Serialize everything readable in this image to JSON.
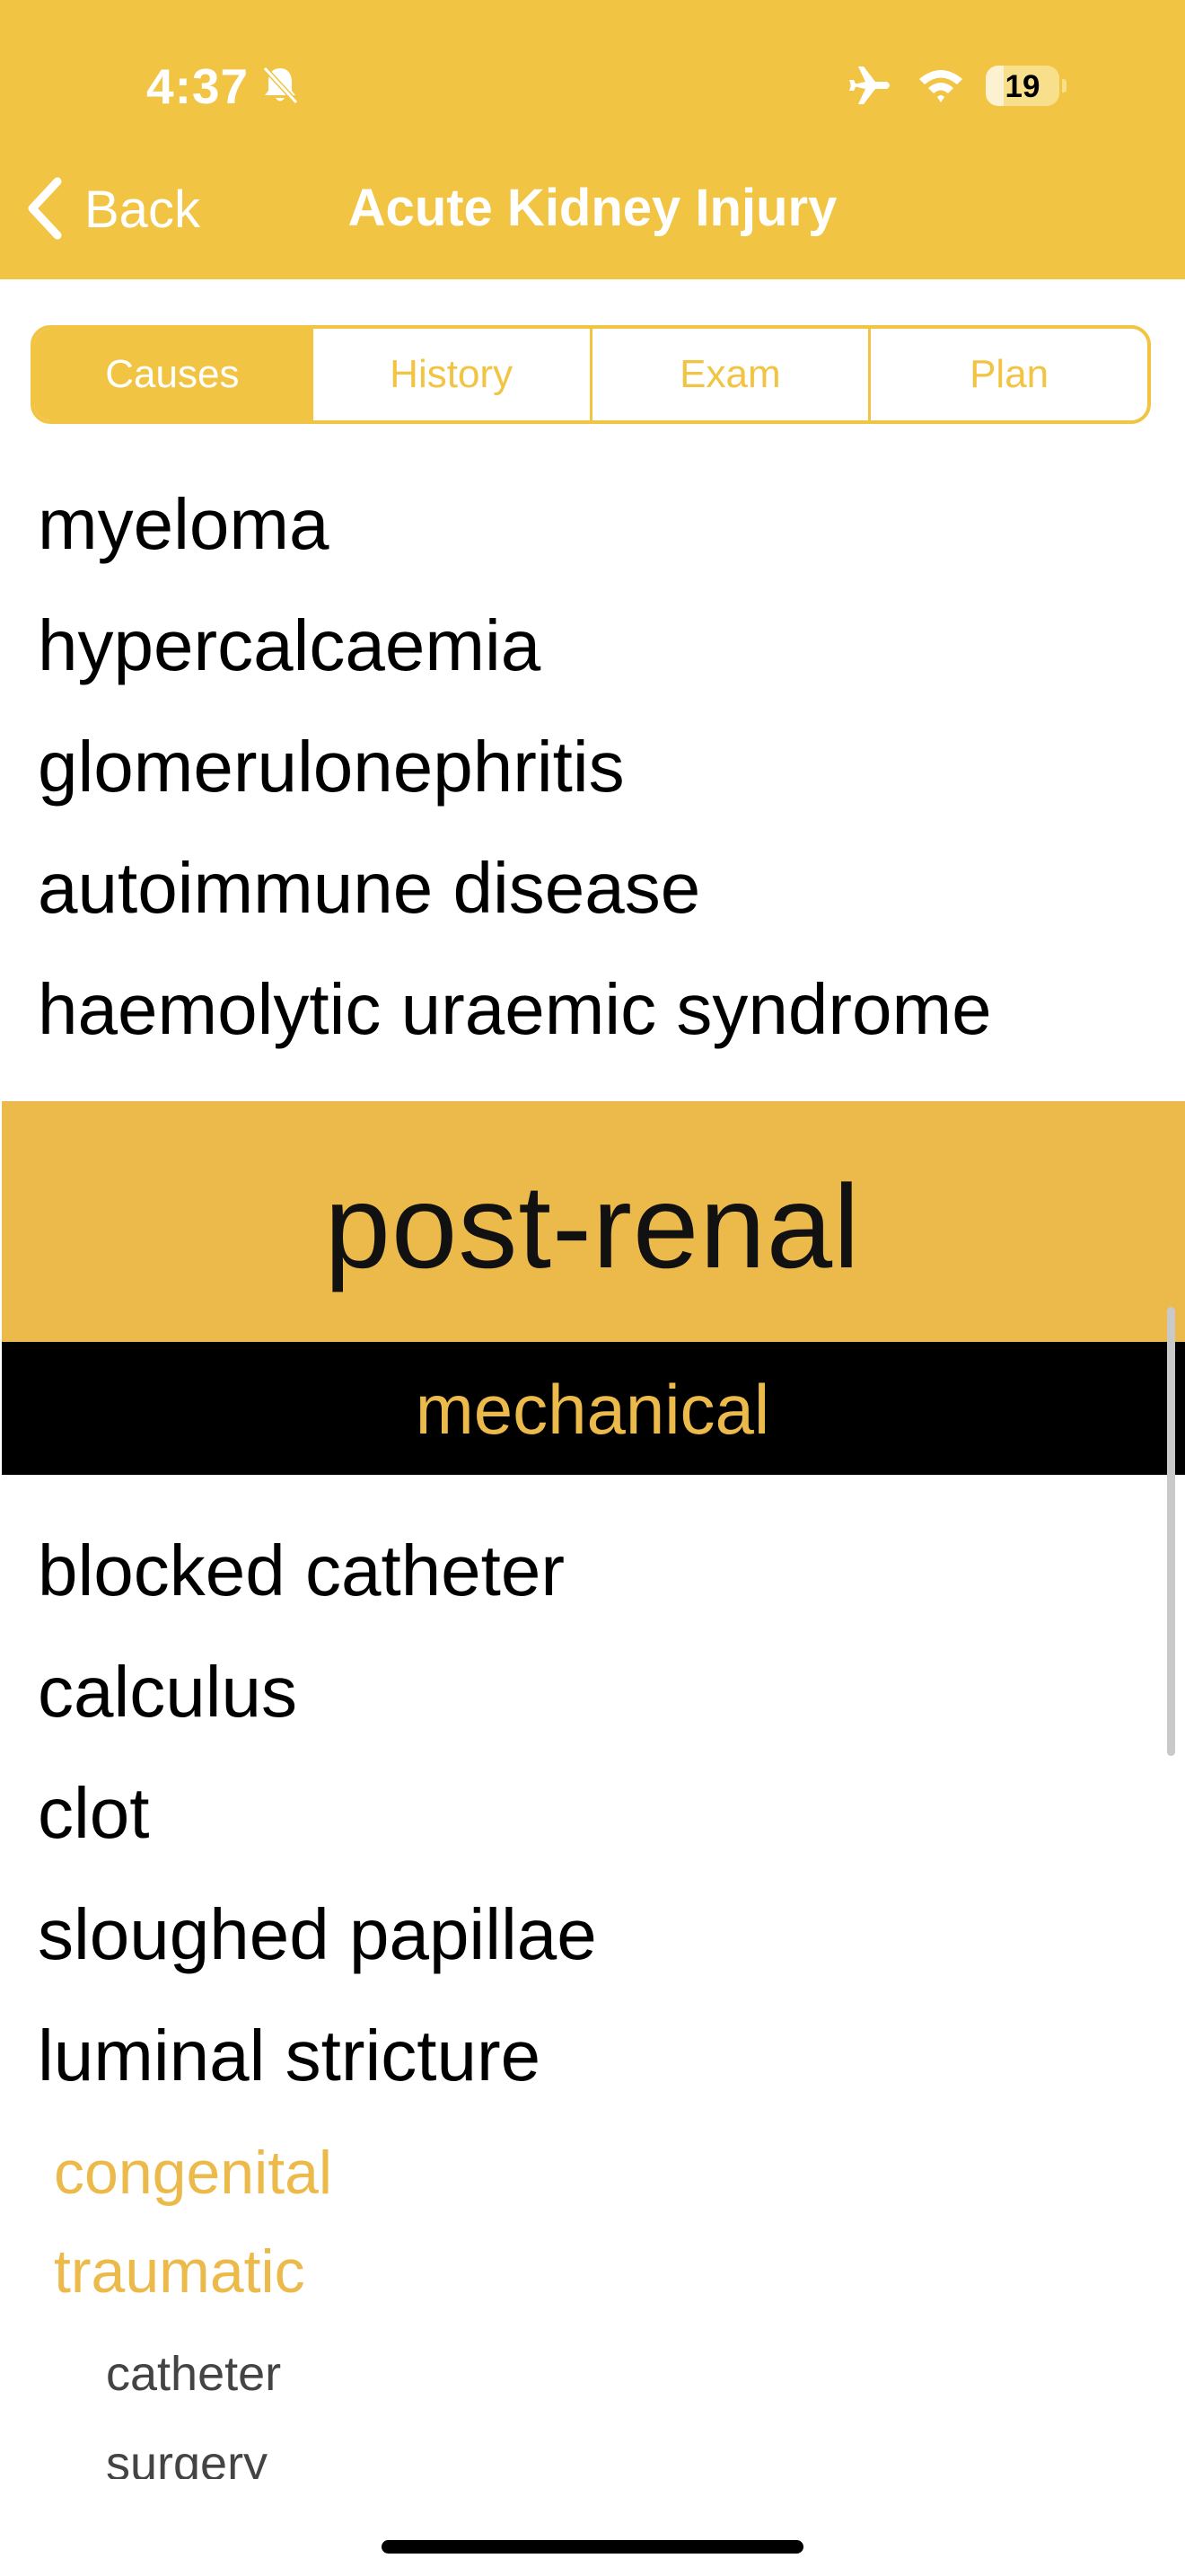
{
  "status_bar": {
    "time": "4:37",
    "battery_level": "19",
    "icons": [
      "bell-slash-icon",
      "airplane-icon",
      "wifi-icon",
      "battery-icon"
    ]
  },
  "nav": {
    "back_label": "Back",
    "title": "Acute Kidney Injury"
  },
  "tabs": [
    {
      "label": "Causes",
      "active": true
    },
    {
      "label": "History",
      "active": false
    },
    {
      "label": "Exam",
      "active": false
    },
    {
      "label": "Plan",
      "active": false
    }
  ],
  "renal_items": [
    "myeloma",
    "hypercalcaemia",
    "glomerulonephritis",
    "autoimmune disease",
    "haemolytic uraemic syndrome"
  ],
  "section": {
    "heading": "post-renal",
    "subheading": "mechanical"
  },
  "mechanical_items": [
    "blocked catheter",
    "calculus",
    "clot",
    "sloughed papillae",
    "luminal stricture"
  ],
  "stricture_subitems": [
    "congenital",
    "traumatic"
  ],
  "traumatic_subitems": [
    "catheter",
    "surgery"
  ],
  "colors": {
    "accent": "#f2c444",
    "section_band": "#ecba4b",
    "subheader_band": "#000000"
  }
}
